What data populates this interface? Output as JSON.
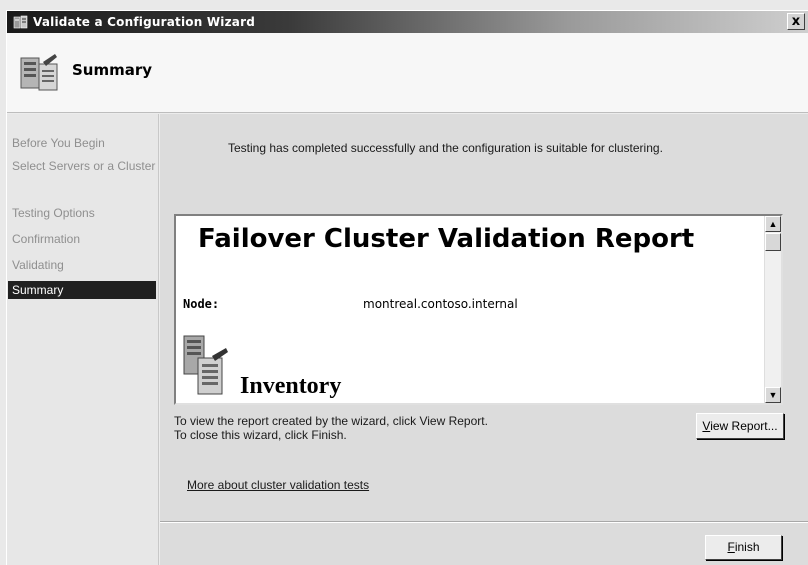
{
  "window": {
    "title": "Validate a Configuration Wizard",
    "close_glyph": "x"
  },
  "header": {
    "title": "Summary",
    "icon": "wizard-report-icon"
  },
  "sidebar": {
    "items": [
      {
        "label": "Before You Begin"
      },
      {
        "label": "Select Servers or a Cluster"
      },
      {
        "label": "Testing Options"
      },
      {
        "label": "Confirmation"
      },
      {
        "label": "Validating"
      },
      {
        "label": "Summary",
        "active": true
      }
    ]
  },
  "main": {
    "status_text": "Testing has completed successfully and the configuration is suitable for clustering.",
    "report": {
      "title": "Failover Cluster Validation Report",
      "node_label": "Node:",
      "node_value": "montreal.contoso.internal",
      "section_heading": "Inventory"
    },
    "hint_line1": "To view the report created by the wizard, click View Report.",
    "hint_line2": "To close this wizard, click Finish.",
    "view_report_button": {
      "accel": "V",
      "rest": "iew Report..."
    },
    "more_link": "More about cluster validation tests",
    "finish_button": {
      "accel": "F",
      "rest": "inish"
    }
  },
  "colors": {
    "active_nav_bg": "#202020",
    "inactive_nav_text": "#8f8f8f",
    "content_bg": "#dcdcdc"
  }
}
